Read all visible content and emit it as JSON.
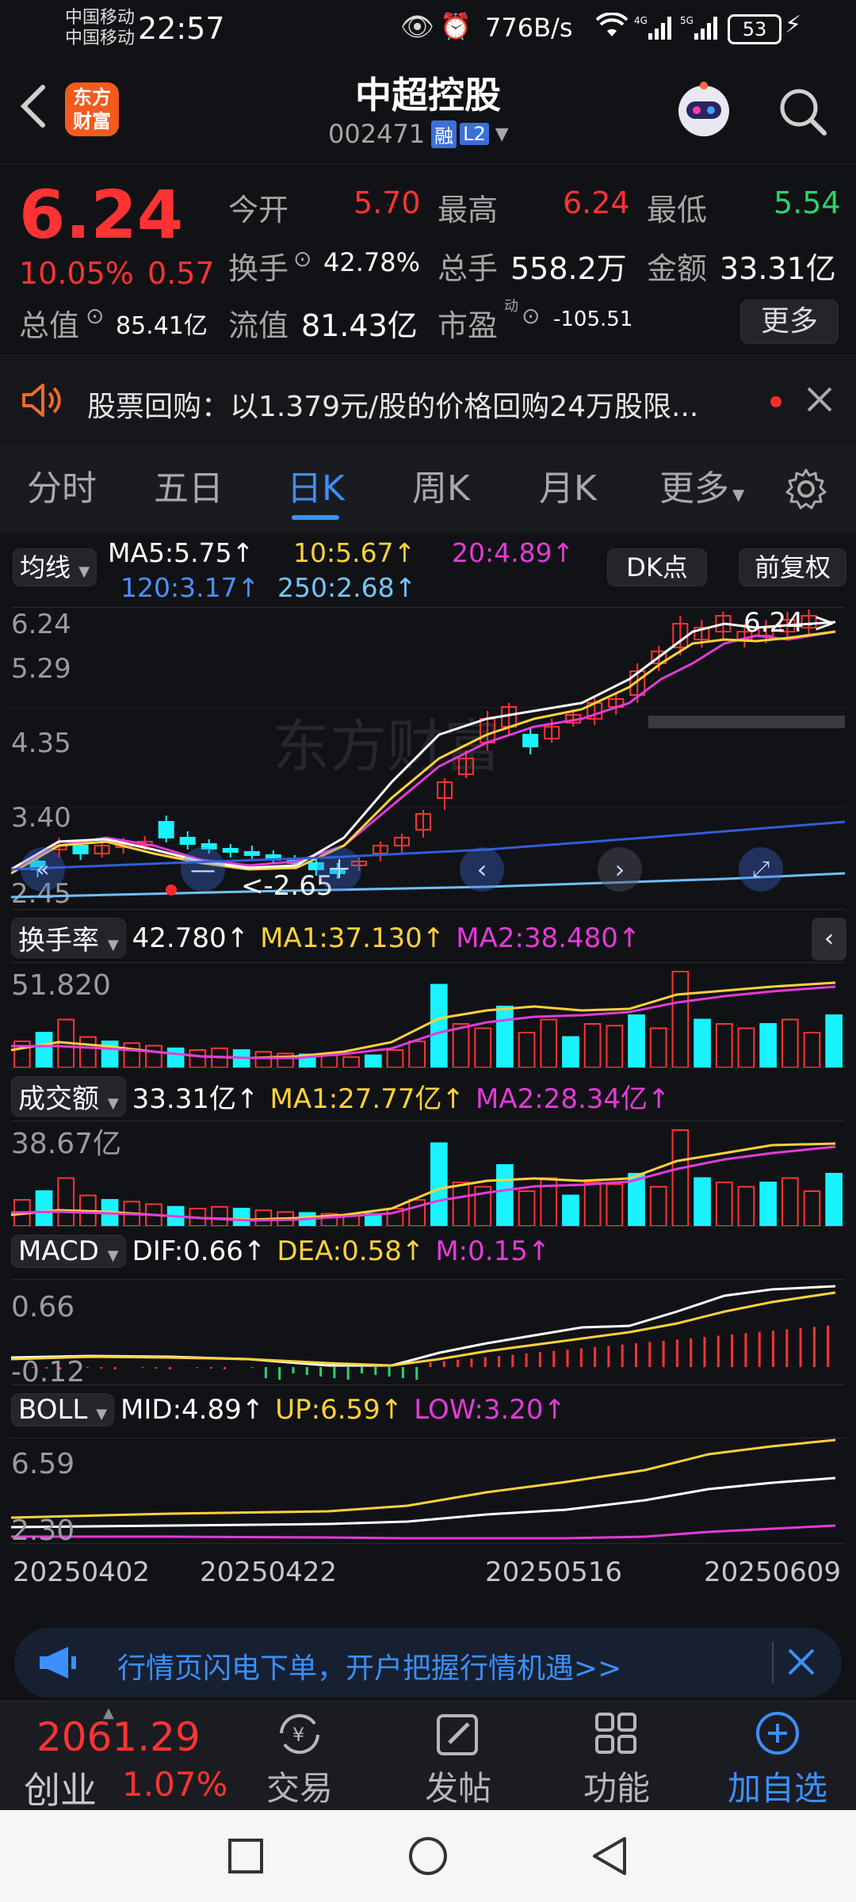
{
  "status_bar": {
    "carrier_1": "中国移动",
    "carrier_2": "中国移动",
    "time": "22:57",
    "net_speed": "776B/s",
    "battery": "53"
  },
  "header": {
    "brand_line1": "东方",
    "brand_line2": "财富",
    "title": "中超控股",
    "code": "002471",
    "tag_margin": "融",
    "tag_level": "L2"
  },
  "quote": {
    "price": "6.24",
    "change_pct": "10.05%",
    "change": "0.57",
    "open_label": "今开",
    "open": "5.70",
    "high_label": "最高",
    "high": "6.24",
    "low_label": "最低",
    "low": "5.54",
    "turnover_label": "换手",
    "turnover": "42.78%",
    "volume_label": "总手",
    "volume": "558.2万",
    "amount_label": "金额",
    "amount": "33.31亿",
    "total_mv_label": "总值",
    "total_mv": "85.41亿",
    "float_mv_label": "流值",
    "float_mv": "81.43亿",
    "pe_label": "市盈",
    "pe_sup": "动",
    "pe": "-105.51",
    "more_button": "更多"
  },
  "notice": {
    "text": "股票回购：以1.379元/股的价格回购24万股限..."
  },
  "tabs": [
    "分时",
    "五日",
    "日K",
    "周K",
    "月K",
    "更多"
  ],
  "active_tab": "日K",
  "kline": {
    "indicator_select": "均线",
    "ma5": "MA5:5.75↑",
    "ma10": "10:5.67↑",
    "ma20": "20:4.89↑",
    "ma120": "120:3.17↑",
    "ma250": "250:2.68↑",
    "dk_button": "DK点",
    "adjust_button": "前复权",
    "y_labels": [
      "6.24",
      "5.29",
      "4.35",
      "3.40",
      "2.45"
    ],
    "high_marker": "6.24->",
    "low_marker": "<-2.65",
    "watermark": "东方财富"
  },
  "turnover_panel": {
    "select": "换手率",
    "value": "42.780↑",
    "ma1": "MA1:37.130↑",
    "ma2": "MA2:38.480↑",
    "y_max": "51.820"
  },
  "amount_panel": {
    "select": "成交额",
    "value": "33.31亿↑",
    "ma1": "MA1:27.77亿↑",
    "ma2": "MA2:28.34亿↑",
    "y_max": "38.67亿"
  },
  "macd_panel": {
    "select": "MACD",
    "dif": "DIF:0.66↑",
    "dea": "DEA:0.58↑",
    "m": "M:0.15↑",
    "y_top": "0.66",
    "y_bottom": "-0.12"
  },
  "boll_panel": {
    "select": "BOLL",
    "mid": "MID:4.89↑",
    "up": "UP:6.59↑",
    "low": "LOW:3.20↑",
    "y_top": "6.59",
    "y_bottom": "2.30"
  },
  "dates": [
    "20250402",
    "20250422",
    "20250516",
    "20250609"
  ],
  "ad_banner": {
    "text": "行情页闪电下单，开户把握行情机遇>>"
  },
  "bottom_bar": {
    "index_value": "2061.29",
    "index_name": "创业",
    "index_change": "1.07%",
    "trade": "交易",
    "post": "发帖",
    "functions": "功能",
    "add_watch": "加自选"
  },
  "colors": {
    "up": "#ff3333",
    "down_fill": "#18f3ff",
    "accent": "#3b8fff",
    "ma5": "#ffffff",
    "ma10": "#ffd23b",
    "ma20": "#e33bd8"
  }
}
